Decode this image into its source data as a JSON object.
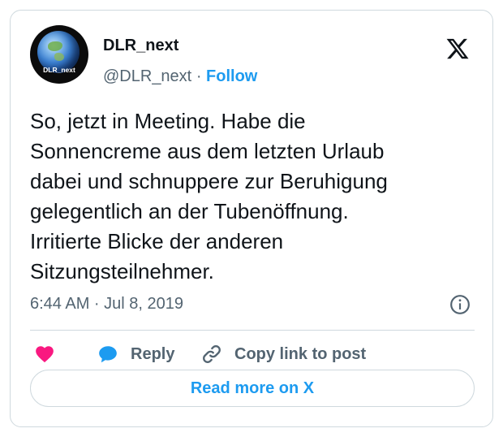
{
  "author": {
    "name": "DLR_next",
    "handle": "@DLR_next",
    "separator": "·",
    "follow_label": "Follow",
    "avatar_text": "DLR_next"
  },
  "tweet": {
    "text_lines": [
      "So, jetzt in Meeting. Habe die",
      "Sonnencreme aus dem letzten Urlaub",
      "dabei und schnuppere zur Beruhigung",
      "gelegentlich an der Tubenöffnung.",
      "Irritierte Blicke der anderen",
      "Sitzungsteilnehmer."
    ],
    "timestamp": "6:44 AM · Jul 8, 2019"
  },
  "actions": {
    "reply_label": "Reply",
    "copy_link_label": "Copy link to post"
  },
  "read_more_label": "Read more on X",
  "icons": {
    "brand": "x-logo-icon",
    "info": "info-icon",
    "like": "heart-icon",
    "reply": "speech-bubble-icon",
    "copy": "link-icon"
  },
  "colors": {
    "accent": "#1d9bf0",
    "heart": "#f91880",
    "muted_text": "#536471",
    "border": "#cfd9de",
    "text": "#0f1419"
  }
}
